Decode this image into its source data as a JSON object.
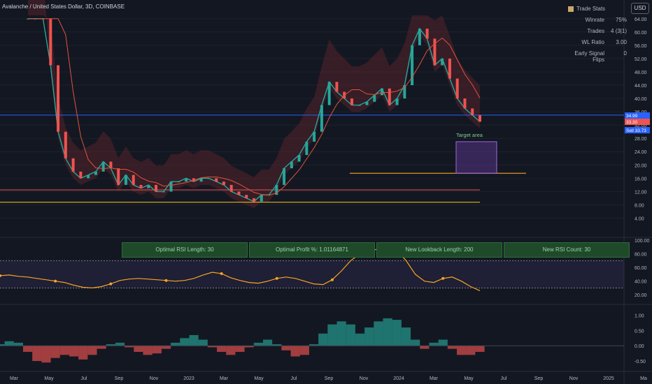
{
  "header": {
    "title": "Avalanche / United States Dollar, 3D, COINBASE",
    "currency_button": "USD"
  },
  "stats": {
    "title": "Trade Stats",
    "rows": [
      {
        "label": "Winrate",
        "value": "75%"
      },
      {
        "label": "Trades",
        "value": "4 (3|1)"
      },
      {
        "label": "WL Ratio",
        "value": "3.00"
      },
      {
        "label": "Early Signal Flips",
        "value": "0"
      }
    ]
  },
  "panels": [
    "Optimal RSI Length: 30",
    "Optimal Profit %: 1.01164871",
    "New Lookback Length: 200",
    "New RSI Count: 30"
  ],
  "annotation": "Target area",
  "price_badges": [
    {
      "label": "",
      "value": "34.99",
      "color": "#2962ff"
    },
    {
      "label": "Sell",
      "value": "33.38",
      "color": "#f5a623"
    },
    {
      "label": "",
      "value": "33.30",
      "color": "#ef5350"
    },
    {
      "label": "Sell",
      "value": "33.73",
      "color": "#2962ff"
    }
  ],
  "colors": {
    "background": "#131722",
    "up": "#26a69a",
    "down": "#ef5350",
    "accent_yellow": "#f5c518",
    "blue_line": "#2962ff"
  },
  "chart_data": [
    {
      "type": "line",
      "title": "Avalanche / United States Dollar, 3D, COINBASE",
      "x_ticks": [
        "Mar",
        "May",
        "Jul",
        "Sep",
        "Nov",
        "2023",
        "Mar",
        "May",
        "Jul",
        "Sep",
        "Nov",
        "2024",
        "Mar",
        "May",
        "Jul",
        "Sep",
        "Nov",
        "2025",
        "Ma"
      ],
      "y_ticks": [
        4.0,
        8.0,
        12.0,
        16.0,
        20.0,
        24.0,
        28.0,
        32.0,
        36.0,
        40.0,
        44.0,
        48.0,
        52.0,
        56.0,
        60.0,
        64.0
      ],
      "ylim": [
        2,
        65
      ],
      "series": [
        {
          "values": [
            88,
            100,
            80,
            50,
            30,
            22,
            18,
            16,
            17,
            18,
            21,
            19,
            14,
            17,
            14,
            13,
            14,
            12,
            12,
            15,
            15,
            16,
            15,
            16,
            16,
            15,
            14,
            12,
            11,
            10,
            9,
            11,
            11,
            14,
            19,
            21,
            23,
            27,
            30,
            38,
            45,
            42,
            40,
            38,
            38,
            39,
            41,
            43,
            38,
            40,
            44,
            56,
            61,
            58,
            50,
            52,
            46,
            40,
            37,
            35,
            33
          ]
        }
      ]
    },
    {
      "type": "line",
      "title": "",
      "y_ticks": [
        20.0,
        40.0,
        60.0,
        80.0,
        100.0
      ],
      "ylim": [
        10,
        100
      ],
      "series": [
        {
          "values": [
            48,
            49,
            47,
            46,
            44,
            42,
            40,
            38,
            34,
            31,
            30,
            32,
            36,
            41,
            43,
            44,
            43,
            42,
            41,
            40,
            41,
            44,
            49,
            53,
            51,
            45,
            41,
            38,
            37,
            40,
            44,
            46,
            44,
            40,
            36,
            35,
            42,
            55,
            70,
            80,
            84,
            87,
            86,
            85,
            70,
            50,
            40,
            38,
            44,
            46,
            40,
            32,
            26
          ]
        }
      ]
    },
    {
      "type": "area",
      "title": "",
      "y_ticks": [
        -0.5,
        0.0,
        0.5,
        1.0
      ],
      "ylim": [
        -0.75,
        1.15
      ],
      "series": [
        {
          "values": [
            0.05,
            0.15,
            0.1,
            -0.2,
            -0.5,
            -0.55,
            -0.4,
            -0.3,
            -0.35,
            -0.45,
            -0.3,
            -0.1,
            0.05,
            0.1,
            -0.05,
            -0.2,
            -0.3,
            -0.25,
            -0.1,
            0.1,
            0.25,
            0.35,
            0.2,
            -0.05,
            -0.2,
            -0.3,
            -0.2,
            -0.05,
            0.1,
            0.2,
            0.05,
            -0.15,
            -0.35,
            -0.3,
            0.05,
            0.4,
            0.7,
            0.8,
            0.7,
            0.4,
            0.6,
            0.8,
            0.9,
            0.85,
            0.6,
            0.2,
            -0.1,
            0.1,
            0.2,
            -0.1,
            -0.3,
            -0.3,
            -0.2
          ]
        }
      ]
    }
  ]
}
